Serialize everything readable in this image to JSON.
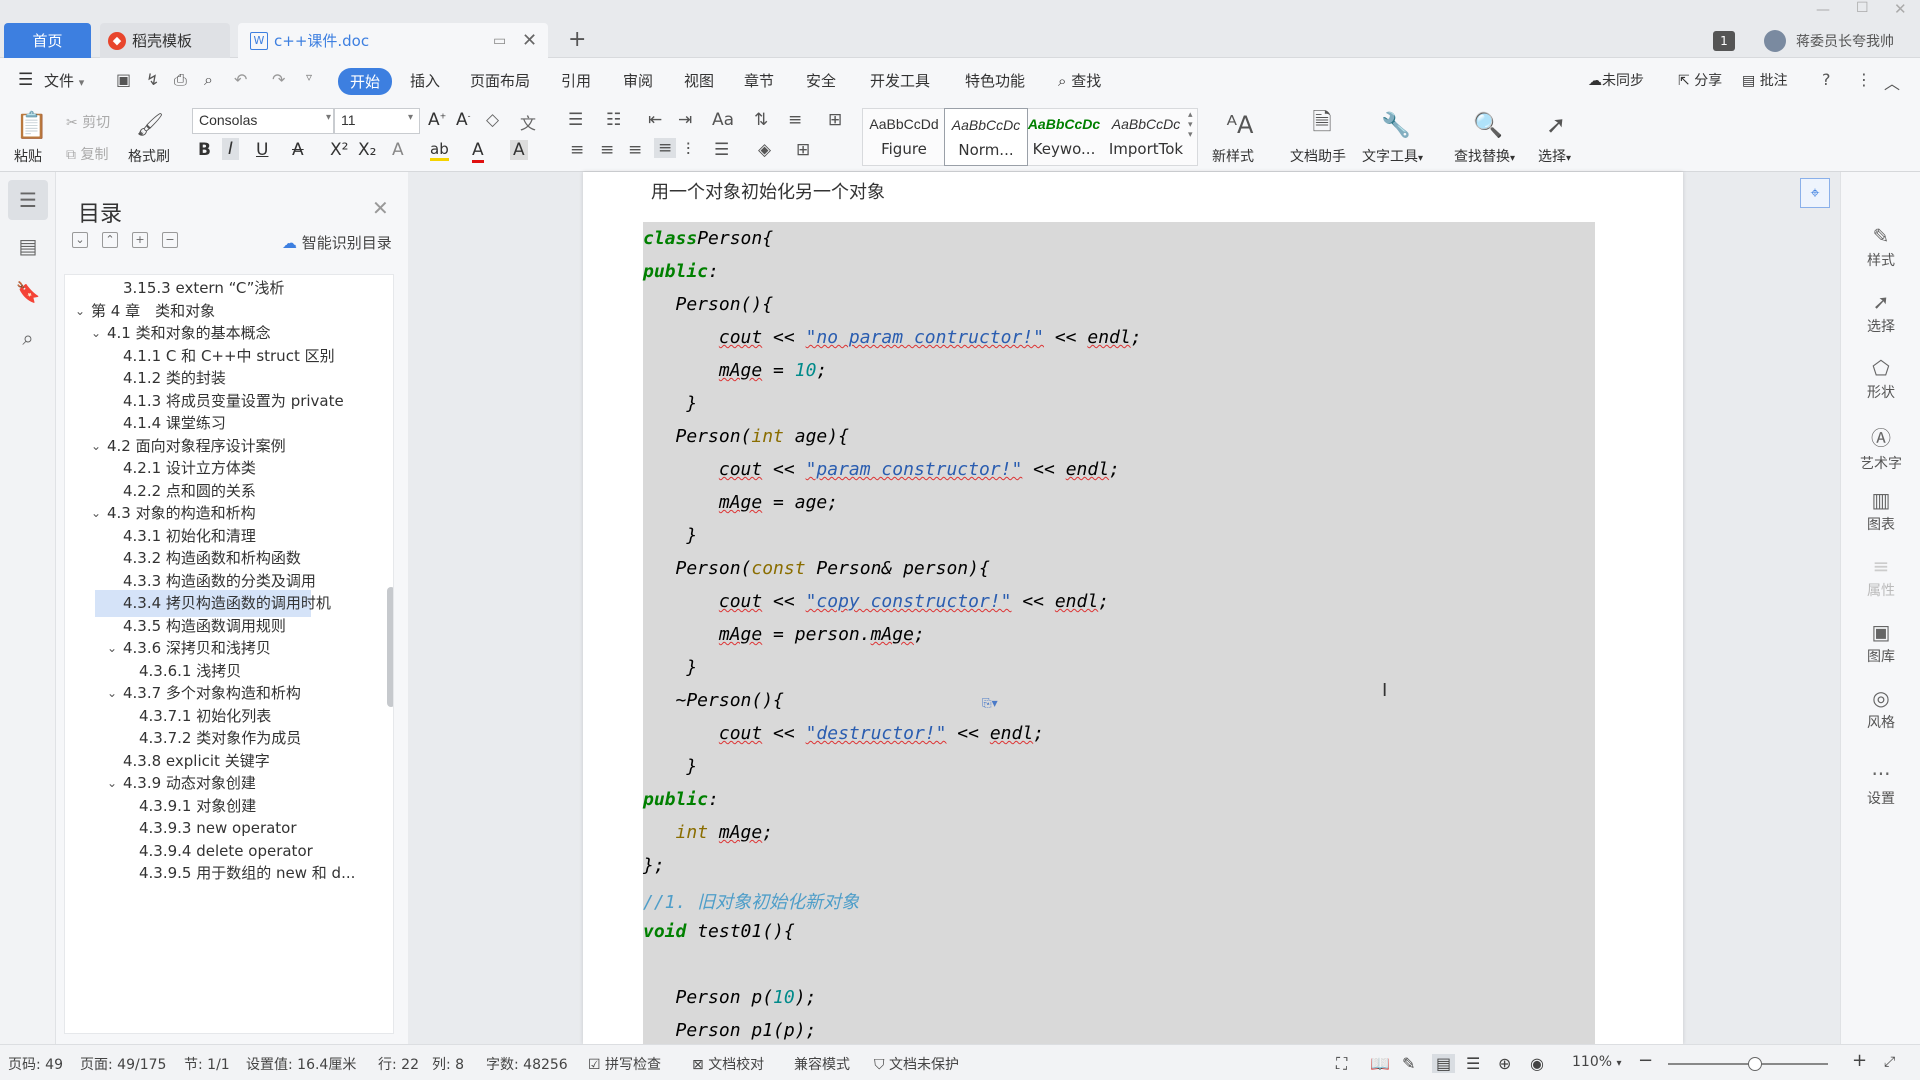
{
  "titlebar": {
    "tabs": [
      {
        "label": "首页"
      },
      {
        "label": "稻壳模板"
      },
      {
        "label": "c++课件.doc"
      }
    ],
    "new_tab": "+",
    "page_count_badge": "1",
    "user_name": "蒋委员长夸我帅"
  },
  "menubar": {
    "items": [
      "文件",
      "开始",
      "插入",
      "页面布局",
      "引用",
      "审阅",
      "视图",
      "章节",
      "安全",
      "开发工具",
      "特色功能",
      "查找"
    ],
    "right": [
      "未同步",
      "分享",
      "批注"
    ]
  },
  "ribbon": {
    "paste": "粘贴",
    "cut": "剪切",
    "copy": "复制",
    "format_painter": "格式刷",
    "font_name": "Consolas",
    "font_size": "11",
    "styles": [
      {
        "sample": "AaBbCcDd",
        "name": "Figure"
      },
      {
        "sample": "AaBbCcDc",
        "name": "Norm..."
      },
      {
        "sample": "AaBbCcDc",
        "name": "Keywo..."
      },
      {
        "sample": "AaBbCcDc",
        "name": "ImportTok"
      }
    ],
    "new_style": "新样式",
    "doc_assistant": "文档助手",
    "text_tools": "文字工具",
    "find_replace": "查找替换",
    "select": "选择"
  },
  "toc": {
    "title": "目录",
    "smart": "智能识别目录",
    "items": [
      {
        "label": "3.15.3 extern “C”浅析",
        "level": 3
      },
      {
        "label": "第 4 章　类和对象",
        "level": 1,
        "expanded": true
      },
      {
        "label": "4.1  类和对象的基本概念",
        "level": 2,
        "expanded": true
      },
      {
        "label": "4.1.1 C 和 C++中 struct 区别",
        "level": 3
      },
      {
        "label": "4.1.2  类的封装",
        "level": 3
      },
      {
        "label": "4.1.3  将成员变量设置为 private",
        "level": 3
      },
      {
        "label": "4.1.4  课堂练习",
        "level": 3
      },
      {
        "label": "4.2  面向对象程序设计案例",
        "level": 2,
        "expanded": true
      },
      {
        "label": "4.2.1  设计立方体类",
        "level": 3
      },
      {
        "label": "4.2.2  点和圆的关系",
        "level": 3
      },
      {
        "label": "4.3  对象的构造和析构",
        "level": 2,
        "expanded": true
      },
      {
        "label": "4.3.1  初始化和清理",
        "level": 3
      },
      {
        "label": "4.3.2  构造函数和析构函数",
        "level": 3
      },
      {
        "label": "4.3.3  构造函数的分类及调用",
        "level": 3
      },
      {
        "label": "4.3.4  拷贝构造函数的调用时机",
        "level": 3,
        "selected": true
      },
      {
        "label": "4.3.5  构造函数调用规则",
        "level": 3
      },
      {
        "label": "4.3.6  深拷贝和浅拷贝",
        "level": 3,
        "expanded": true
      },
      {
        "label": "4.3.6.1  浅拷贝",
        "level": 4
      },
      {
        "label": "4.3.7  多个对象构造和析构",
        "level": 3,
        "expanded": true
      },
      {
        "label": "4.3.7.1  初始化列表",
        "level": 4
      },
      {
        "label": "4.3.7.2  类对象作为成员",
        "level": 4
      },
      {
        "label": "4.3.8 explicit 关键字",
        "level": 3
      },
      {
        "label": "4.3.9  动态对象创建",
        "level": 3,
        "expanded": true
      },
      {
        "label": "4.3.9.1  对象创建",
        "level": 4
      },
      {
        "label": "4.3.9.3 new operator",
        "level": 4
      },
      {
        "label": "4.3.9.4 delete operator",
        "level": 4
      },
      {
        "label": "4.3.9.5  用于数组的 new 和 d...",
        "level": 4
      }
    ]
  },
  "document": {
    "heading": "用一个对象初始化另一个对象",
    "code_lines": [
      [
        [
          "kw",
          "class"
        ],
        [
          "",
          "Person{"
        ]
      ],
      [
        [
          "kw",
          "public"
        ],
        [
          "",
          ":"
        ]
      ],
      [
        [
          "",
          "   Person(){"
        ]
      ],
      [
        [
          "",
          "       "
        ],
        [
          "ul",
          "cout"
        ],
        [
          "",
          " << "
        ],
        [
          "str",
          "\"no param contructor!\""
        ],
        [
          "",
          " << "
        ],
        [
          "ul",
          "endl"
        ],
        [
          "",
          ";"
        ]
      ],
      [
        [
          "",
          "       "
        ],
        [
          "ul",
          "mAge"
        ],
        [
          "",
          " = "
        ],
        [
          "num",
          "10"
        ],
        [
          "",
          ";"
        ]
      ],
      [
        [
          "",
          "    }"
        ]
      ],
      [
        [
          "",
          "   Person("
        ],
        [
          "ty",
          "int"
        ],
        [
          "",
          " age){"
        ]
      ],
      [
        [
          "",
          "       "
        ],
        [
          "ul",
          "cout"
        ],
        [
          "",
          " << "
        ],
        [
          "str",
          "\"param constructor!\""
        ],
        [
          "",
          " << "
        ],
        [
          "ul",
          "endl"
        ],
        [
          "",
          ";"
        ]
      ],
      [
        [
          "",
          "       "
        ],
        [
          "ul",
          "mAge"
        ],
        [
          "",
          " = age;"
        ]
      ],
      [
        [
          "",
          "    }"
        ]
      ],
      [
        [
          "",
          "   Person("
        ],
        [
          "ty",
          "const"
        ],
        [
          "",
          " Person& person){"
        ]
      ],
      [
        [
          "",
          "       "
        ],
        [
          "ul",
          "cout"
        ],
        [
          "",
          " << "
        ],
        [
          "str",
          "\"copy constructor!\""
        ],
        [
          "",
          " << "
        ],
        [
          "ul",
          "endl"
        ],
        [
          "",
          ";"
        ]
      ],
      [
        [
          "",
          "       "
        ],
        [
          "ul",
          "mAge"
        ],
        [
          "",
          " = person."
        ],
        [
          "ul",
          "mAge"
        ],
        [
          "",
          ";"
        ]
      ],
      [
        [
          "",
          "    }"
        ]
      ],
      [
        [
          "",
          "   ~Person(){"
        ]
      ],
      [
        [
          "",
          "       "
        ],
        [
          "ul",
          "cout"
        ],
        [
          "",
          " << "
        ],
        [
          "str",
          "\"destructor!\""
        ],
        [
          "",
          " << "
        ],
        [
          "ul",
          "endl"
        ],
        [
          "",
          ";"
        ]
      ],
      [
        [
          "",
          "    }"
        ]
      ],
      [
        [
          "kw",
          "public"
        ],
        [
          "",
          ":"
        ]
      ],
      [
        [
          "",
          "   "
        ],
        [
          "ty",
          "int"
        ],
        [
          "",
          " "
        ],
        [
          "ul",
          "mAge"
        ],
        [
          "",
          ";"
        ]
      ],
      [
        [
          "",
          "};"
        ]
      ],
      [
        [
          "cm",
          "//1. 旧对象初始化新对象"
        ]
      ],
      [
        [
          "kw",
          "void"
        ],
        [
          "",
          " test01(){"
        ]
      ],
      [
        [
          "",
          ""
        ]
      ],
      [
        [
          "",
          "   Person p("
        ],
        [
          "num",
          "10"
        ],
        [
          "",
          ");"
        ]
      ],
      [
        [
          "",
          "   Person p1(p);"
        ]
      ]
    ]
  },
  "righttools": [
    "样式",
    "选择",
    "形状",
    "艺术字",
    "图表",
    "属性",
    "图库",
    "风格",
    "设置"
  ],
  "status": {
    "page_num": "页码: 49",
    "pages": "页面: 49/175",
    "section": "节: 1/1",
    "setting": "设置值: 16.4厘米",
    "row": "行: 22",
    "col": "列: 8",
    "word_count": "字数: 48256",
    "spellcheck": "拼写检查",
    "proofread": "文档校对",
    "compat": "兼容模式",
    "protect": "文档未保护",
    "zoom": "110%"
  }
}
